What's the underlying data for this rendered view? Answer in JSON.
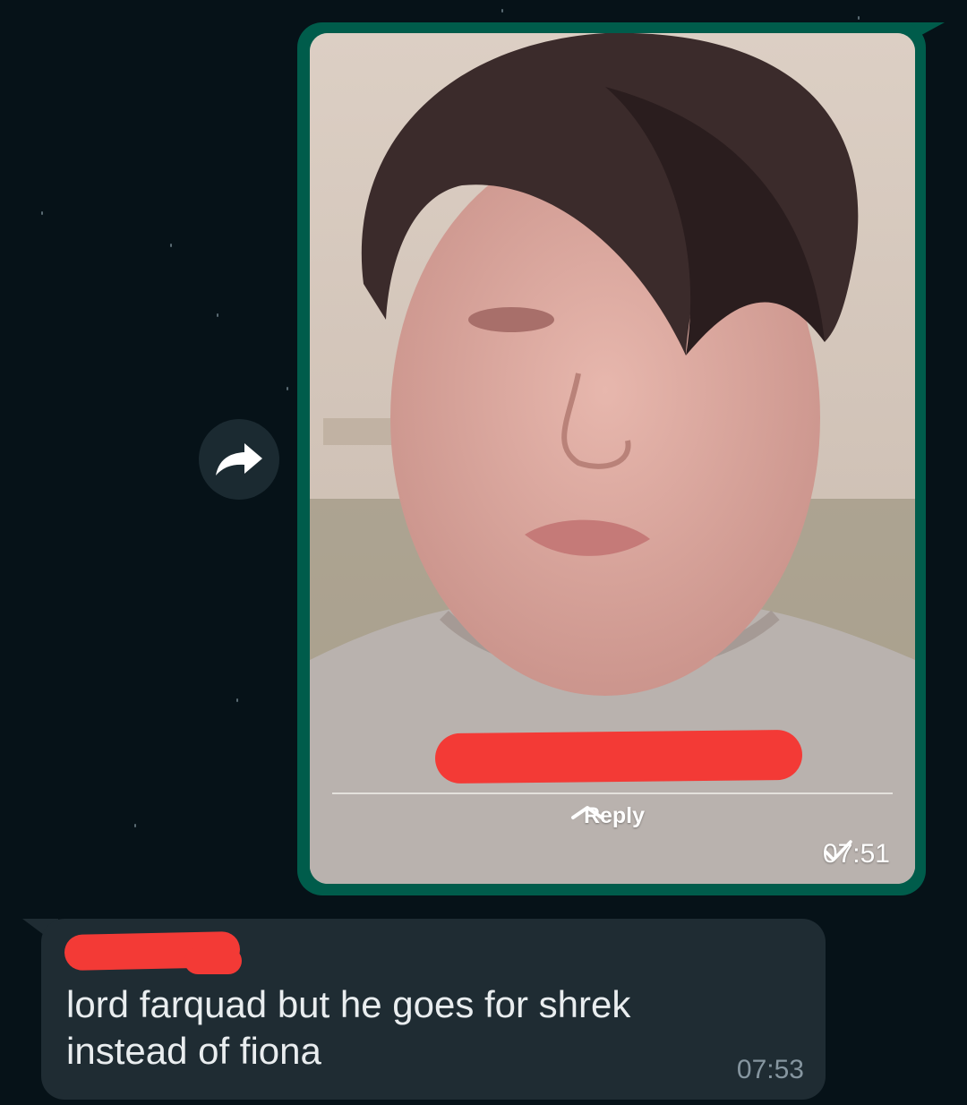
{
  "colors": {
    "background": "#061218",
    "sent_bubble": "#005c4b",
    "received_bubble": "#1f2c33",
    "redaction": "#f33a36",
    "message_text": "#e9edef",
    "time_text": "#8696a0"
  },
  "forward_button": {
    "icon": "forward-arrow-icon"
  },
  "sent_message": {
    "type": "image",
    "reply_label": "Reply",
    "reply_icon": "chevron-up-icon",
    "time": "07:51",
    "status_icon": "single-check-icon"
  },
  "received_message": {
    "text_line1": "lord farquad but he goes for shrek",
    "text_line2": "instead of fiona",
    "time": "07:53"
  }
}
